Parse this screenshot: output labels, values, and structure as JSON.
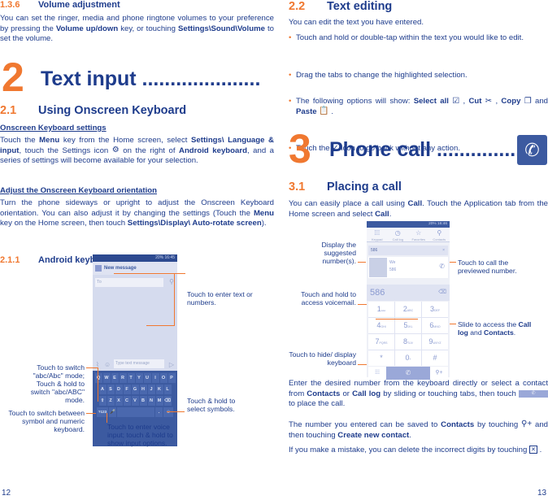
{
  "left_page": {
    "section_136": {
      "num": "1.3.6",
      "title": "Volume adjustment"
    },
    "volume_text": {
      "p1": "You can set the ringer, media and phone ringtone volumes to your preference by pressing the ",
      "b1": "Volume up/down",
      "p2": " key, or touching ",
      "b2": "Settings\\Sound\\Volume",
      "p3": " to set the volume."
    },
    "chapter2": {
      "num": "2",
      "title": "Text input ....................."
    },
    "section_21": {
      "num": "2.1",
      "title": "Using Onscreen Keyboard"
    },
    "kbd_settings": {
      "heading": "Onscreen Keyboard settings",
      "p1": "Touch the ",
      "b1": "Menu",
      "p2": " key from the Home screen, select ",
      "b2": "Settings\\ Language & input",
      "p3": ", touch the Settings icon ",
      "p4": " on the right of ",
      "b3": "Android keyboard",
      "p5": ", and a series of settings will become available for your selection."
    },
    "kbd_orientation": {
      "heading": "Adjust the Onscreen Keyboard orientation",
      "p1": "Turn the phone sideways or upright to adjust the Onscreen Keyboard orientation. You can also adjust it by changing the settings (Touch the ",
      "b1": "Menu",
      "p2": " key on the Home screen, then touch ",
      "b2": "Settings\\Display\\ Auto-rotate screen",
      "p3": ")."
    },
    "section_211": {
      "num": "2.1.1",
      "title": "Android keyboard"
    },
    "phone": {
      "status": "20% 16:45",
      "title": "New message",
      "to_placeholder": "To",
      "type_placeholder": "Type text message",
      "rows": [
        [
          "Q",
          "W",
          "E",
          "R",
          "T",
          "Y",
          "U",
          "I",
          "O",
          "P"
        ],
        [
          "A",
          "S",
          "D",
          "F",
          "G",
          "H",
          "J",
          "K",
          "L"
        ],
        [
          "⇧",
          "Z",
          "X",
          "C",
          "V",
          "B",
          "N",
          "M",
          "⌫"
        ]
      ],
      "sym_key": "?123"
    },
    "callouts": {
      "enter_text": "Touch to enter text or numbers.",
      "switch_mode": "Touch to switch \"abc/Abc\" mode; Touch & hold to switch \"abc/ABC\" mode.",
      "switch_symbol": "Touch to switch between symbol and numeric keyboard.",
      "voice": "Touch to enter voice input; touch & hold to show input options.",
      "symbols": "Touch & hold to select symbols."
    },
    "page_number": "12"
  },
  "right_page": {
    "section_22": {
      "num": "2.2",
      "title": "Text editing"
    },
    "intro": "You can edit the text you have entered.",
    "bullets": {
      "b1": "Touch and hold or double-tap within the text you would like to edit.",
      "b2": "Drag the tabs to change the highlighted selection.",
      "b3_pre": "The following options will show: ",
      "select_all": "Select all",
      "cut": "Cut",
      "copy": "Copy",
      "and": " and ",
      "paste": "Paste",
      "b4_pre": "Touch the ",
      "b4_post": " icon to go back without any action."
    },
    "chapter3": {
      "num": "3",
      "title": "Phone call ..............."
    },
    "section_31": {
      "num": "3.1",
      "title": "Placing a call"
    },
    "placing": {
      "p1": "You can easily place a call using ",
      "b1": "Call",
      "p2": ". Touch the Application tab from the Home screen and select ",
      "b2": "Call",
      "p3": "."
    },
    "phone": {
      "status": "20% 16:46",
      "tabs": [
        "Keypad",
        "Call log",
        "Favorites",
        "Contacts"
      ],
      "search": "586",
      "contact_name": "We",
      "contact_num": "586",
      "number": "586",
      "keys": [
        [
          "1",
          "ωω"
        ],
        [
          "2",
          "ABC"
        ],
        [
          "3",
          "DEF"
        ],
        [
          "4",
          "GHI"
        ],
        [
          "5",
          "JKL"
        ],
        [
          "6",
          "MNO"
        ],
        [
          "7",
          "PQRS"
        ],
        [
          "8",
          "TUV"
        ],
        [
          "9",
          "WXYZ"
        ],
        [
          "*",
          ""
        ],
        [
          "0",
          "+"
        ],
        [
          "#",
          ""
        ]
      ]
    },
    "callouts": {
      "suggested": "Display the suggested number(s).",
      "voicemail": "Touch and hold to access voicemail.",
      "hide_kbd": "Touch to hide/ display keyboard",
      "call_preview": "Touch to call the previewed number.",
      "slide_pre": "Slide to access the ",
      "slide_b1": "Call log",
      "slide_mid": " and ",
      "slide_b2": "Contacts",
      "slide_post": "."
    },
    "enter_para": {
      "p1": "Enter the desired number from the keyboard directly or select a contact from ",
      "b1": "Contacts",
      "p2": " or ",
      "b2": "Call log",
      "p3": " by sliding or touching tabs, then touch ",
      "p4": " to place the call."
    },
    "save_para": {
      "p1": "The number you entered can be saved to ",
      "b1": "Contacts",
      "p2": " by touching ",
      "p3": " and then touching ",
      "b2": "Create new contact",
      "p4": "."
    },
    "mistake_para": {
      "p1": "If you make a mistake, you can delete the incorrect digits by touching ",
      "p2": " ."
    },
    "page_number": "13"
  }
}
